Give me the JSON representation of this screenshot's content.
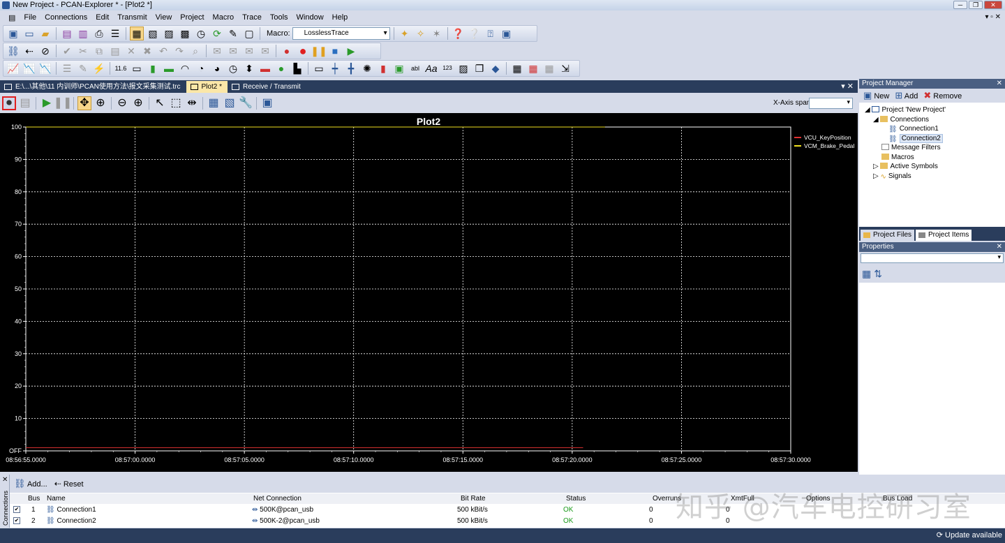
{
  "window": {
    "title": "New Project - PCAN-Explorer * - [Plot2 *]"
  },
  "menu": [
    "File",
    "Connections",
    "Edit",
    "Transmit",
    "View",
    "Project",
    "Macro",
    "Trace",
    "Tools",
    "Window",
    "Help"
  ],
  "toolbar": {
    "macro_label": "Macro:",
    "macro_value": "LosslessTrace"
  },
  "doc_tabs": [
    {
      "label": "E:\\...\\其他\\11 内训师\\PCAN使用方法\\报文采集测试.trc",
      "active": false
    },
    {
      "label": "Plot2 *",
      "active": true
    },
    {
      "label": "Receive / Transmit",
      "active": false
    }
  ],
  "plot_toolbar": {
    "xspan_label": "X-Axis span:",
    "xspan_value": ""
  },
  "chart_data": {
    "type": "line",
    "title": "Plot2",
    "xlabel": "",
    "ylabel": "",
    "ylim": [
      0,
      100
    ],
    "y_ticks": [
      "OFF",
      "10",
      "20",
      "30",
      "40",
      "50",
      "60",
      "70",
      "80",
      "90",
      "100"
    ],
    "x_ticks": [
      "08:56:55.0000",
      "08:57:00.0000",
      "08:57:05.0000",
      "08:57:10.0000",
      "08:57:15.0000",
      "08:57:20.0000",
      "08:57:25.0000",
      "08:57:30.0000"
    ],
    "grid": true,
    "legend_position": "top-right",
    "series": [
      {
        "name": "VCU_KeyPosition",
        "color": "#e03030",
        "x_start": "08:56:55.0000",
        "x_end": "08:57:20.5000",
        "values": [
          1,
          1
        ]
      },
      {
        "name": "VCM_Brake_Pedal",
        "color": "#f0e020",
        "x_start": "08:56:55.0000",
        "x_end": "08:57:21.5000",
        "values": [
          100,
          100
        ]
      }
    ],
    "colors": {
      "background": "#000000",
      "grid": "#ffffff",
      "axis": "#ffffff",
      "text": "#ffffff"
    }
  },
  "project_manager": {
    "title": "Project Manager",
    "toolbar": {
      "new": "New",
      "add": "Add",
      "remove": "Remove"
    },
    "tree": [
      {
        "label": "Project 'New Project'",
        "level": 0,
        "icon": "project-icon"
      },
      {
        "label": "Connections",
        "level": 1,
        "icon": "folder-icon"
      },
      {
        "label": "Connection1",
        "level": 2,
        "icon": "connection-icon"
      },
      {
        "label": "Connection2",
        "level": 2,
        "icon": "connection-icon",
        "selected": true
      },
      {
        "label": "Message Filters",
        "level": 1,
        "icon": "filter-icon"
      },
      {
        "label": "Macros",
        "level": 1,
        "icon": "macro-icon"
      },
      {
        "label": "Active Symbols",
        "level": 1,
        "icon": "symbols-icon"
      },
      {
        "label": "Signals",
        "level": 1,
        "icon": "signals-icon"
      }
    ],
    "tabs": [
      {
        "label": "Project Files",
        "active": false
      },
      {
        "label": "Project Items",
        "active": true
      }
    ]
  },
  "properties": {
    "title": "Properties"
  },
  "connections_panel": {
    "side_label": "Connections",
    "toolbar": {
      "add": "Add...",
      "reset": "Reset"
    },
    "columns": [
      "Bus",
      "Name",
      "Net Connection",
      "Bit Rate",
      "Status",
      "Overruns",
      "XmtFull",
      "Options",
      "Bus Load"
    ],
    "rows": [
      {
        "checked": true,
        "bus": "1",
        "name": "Connection1",
        "net": "500K@pcan_usb",
        "bitrate": "500 kBit/s",
        "status": "OK",
        "overruns": "0",
        "xmtfull": "0"
      },
      {
        "checked": true,
        "bus": "2",
        "name": "Connection2",
        "net": "500K-2@pcan_usb",
        "bitrate": "500 kBit/s",
        "status": "OK",
        "overruns": "0",
        "xmtfull": "0"
      }
    ]
  },
  "statusbar": {
    "update": "Update available"
  },
  "watermark": "知乎 @汽车电控研习室"
}
